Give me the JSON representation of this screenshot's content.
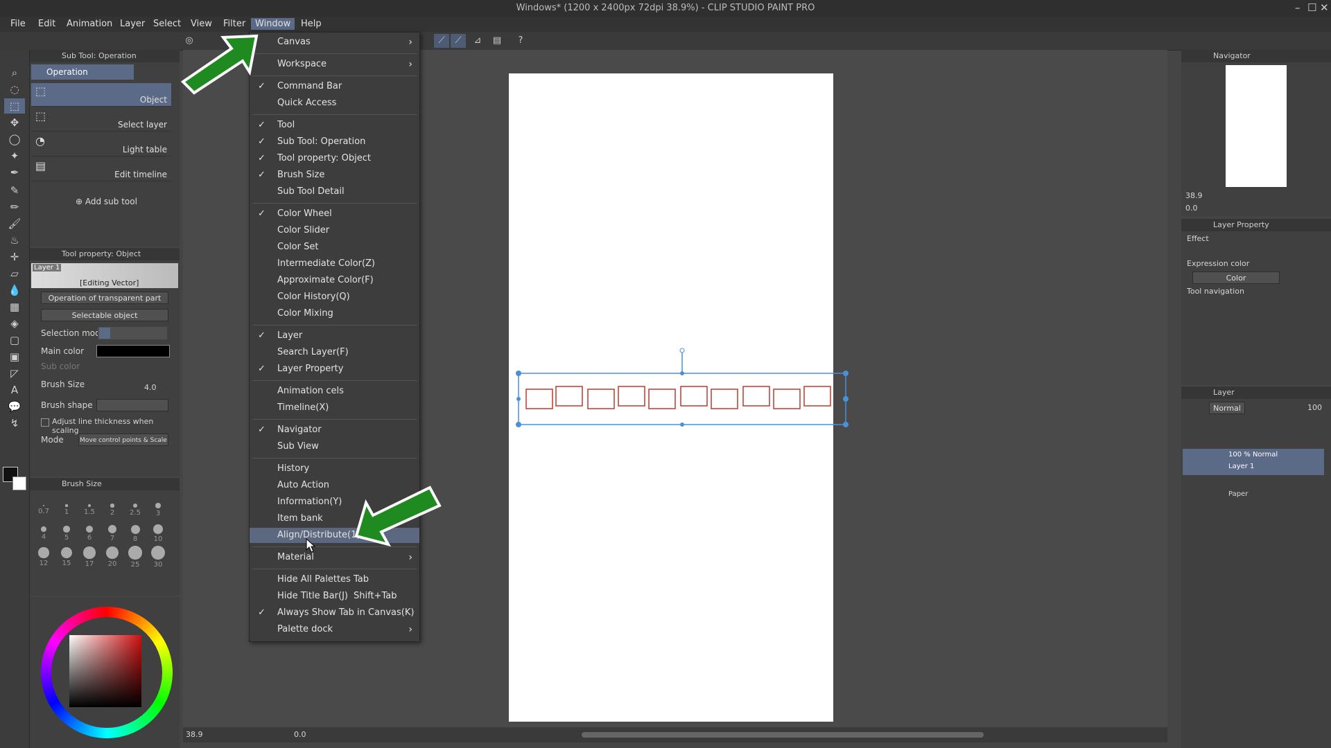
{
  "title": "Windows* (1200 x 2400px 72dpi 38.9%) - CLIP STUDIO PAINT PRO",
  "menubar": {
    "items": [
      "File",
      "Edit",
      "Animation",
      "Layer",
      "Select",
      "View",
      "Filter",
      "Window",
      "Help"
    ],
    "active": "Window"
  },
  "subtool_panel": {
    "title": "Sub Tool: Operation",
    "group": "Operation",
    "items": [
      "Object",
      "Select layer",
      "Light table",
      "Edit timeline"
    ],
    "add_label": "Add sub tool"
  },
  "tool_property": {
    "title": "Tool property: Object",
    "layer_name": "Layer 1",
    "editing": "[Editing Vector]",
    "transparent_op": "Operation of transparent part",
    "selectable": "Selectable object",
    "selection_mode_label": "Selection mode",
    "main_color_label": "Main color",
    "sub_color_label": "Sub color",
    "brush_size_label": "Brush Size",
    "brush_size_value": "4.0",
    "brush_shape_label": "Brush shape",
    "adjust_label": "Adjust line thickness when scaling",
    "mode_label": "Mode",
    "mode_value": "Move control points & Scale"
  },
  "brush_size_panel": {
    "title": "Brush Size",
    "sizes": [
      "0.7",
      "1",
      "1.5",
      "2",
      "2.5",
      "3",
      "4",
      "5",
      "6",
      "7",
      "8",
      "10",
      "12",
      "15",
      "17",
      "20",
      "25",
      "30"
    ]
  },
  "window_menu": {
    "items": [
      {
        "label": "Canvas",
        "check": false,
        "submenu": true
      },
      {
        "sep": true
      },
      {
        "label": "Workspace",
        "check": false,
        "submenu": true
      },
      {
        "sep": true
      },
      {
        "label": "Command Bar",
        "check": true
      },
      {
        "label": "Quick Access",
        "check": false
      },
      {
        "sep": true
      },
      {
        "label": "Tool",
        "check": true
      },
      {
        "label": "Sub Tool: Operation",
        "check": true
      },
      {
        "label": "Tool property: Object",
        "check": true
      },
      {
        "label": "Brush Size",
        "check": true
      },
      {
        "label": "Sub Tool Detail",
        "check": false
      },
      {
        "sep": true
      },
      {
        "label": "Color Wheel",
        "check": true
      },
      {
        "label": "Color Slider",
        "check": false
      },
      {
        "label": "Color Set",
        "check": false
      },
      {
        "label": "Intermediate Color(Z)",
        "check": false
      },
      {
        "label": "Approximate Color(F)",
        "check": false
      },
      {
        "label": "Color History(Q)",
        "check": false
      },
      {
        "label": "Color Mixing",
        "check": false
      },
      {
        "sep": true
      },
      {
        "label": "Layer",
        "check": true
      },
      {
        "label": "Search Layer(F)",
        "check": false
      },
      {
        "label": "Layer Property",
        "check": true
      },
      {
        "sep": true
      },
      {
        "label": "Animation cels",
        "check": false
      },
      {
        "label": "Timeline(X)",
        "check": false
      },
      {
        "sep": true
      },
      {
        "label": "Navigator",
        "check": true
      },
      {
        "label": "Sub View",
        "check": false
      },
      {
        "sep": true
      },
      {
        "label": "History",
        "check": false
      },
      {
        "label": "Auto Action",
        "check": false
      },
      {
        "label": "Information(Y)",
        "check": false
      },
      {
        "label": "Item bank",
        "check": false
      },
      {
        "label": "Align/Distribute(1)",
        "check": false,
        "highlight": true
      },
      {
        "sep": true
      },
      {
        "label": "Material",
        "check": false,
        "submenu": true
      },
      {
        "sep": true
      },
      {
        "label": "Hide All Palettes",
        "check": false,
        "shortcut": "Tab"
      },
      {
        "label": "Hide Title Bar(J)",
        "check": false,
        "shortcut": "Shift+Tab"
      },
      {
        "label": "Always Show Tab in Canvas(K)",
        "check": true
      },
      {
        "label": "Palette dock",
        "check": false,
        "submenu": true
      }
    ]
  },
  "navigator": {
    "title": "Navigator",
    "zoom": "38.9",
    "rotation": "0.0"
  },
  "layer_property": {
    "title": "Layer Property",
    "effect_label": "Effect",
    "expression_label": "Expression color",
    "expression_value": "Color",
    "tool_nav_label": "Tool navigation"
  },
  "layer_panel": {
    "title": "Layer",
    "blend": "Normal",
    "opacity": "100",
    "layers": [
      {
        "mode": "100 % Normal",
        "name": "Layer 1"
      },
      {
        "mode": "",
        "name": "Paper"
      }
    ]
  },
  "statusbar": {
    "zoom": "38.9",
    "angle": "0.0"
  },
  "colors": {
    "accent": "#5b6a86",
    "arrow": "#1f8a1f",
    "frame": "#c0392b",
    "selection": "#4a90d9"
  }
}
